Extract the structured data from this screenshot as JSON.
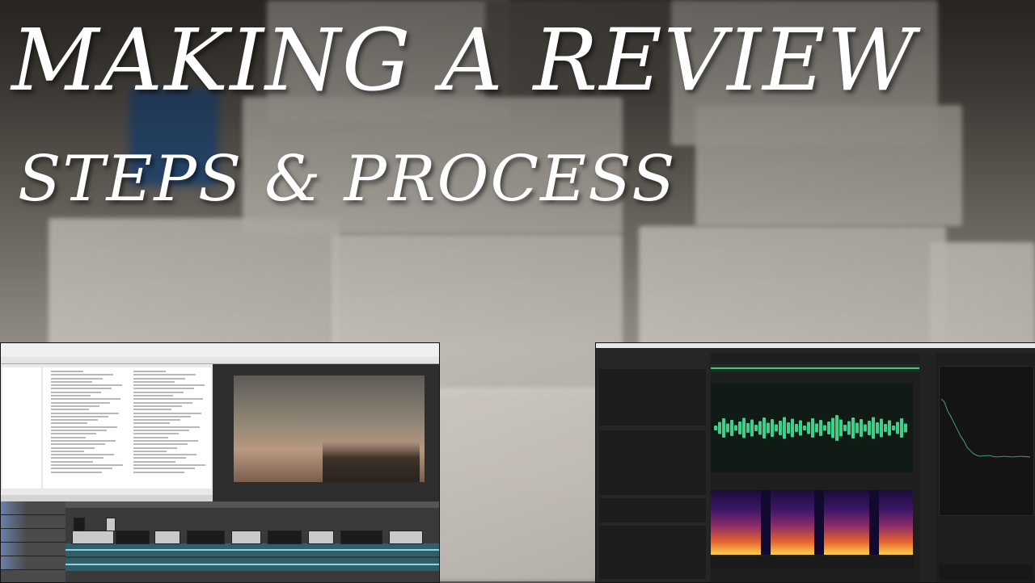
{
  "thumbnail": {
    "title": "MAKING A REVIEW",
    "subtitle": "STEPS & PROCESS",
    "text_color": "#ffffff"
  },
  "vegas_window": {
    "icon": "vegas-app-icon"
  },
  "audition_window": {
    "icon": "audition-app-icon",
    "waveform_color": "#3fcf8a",
    "timecode_color": "#2f7dff"
  }
}
